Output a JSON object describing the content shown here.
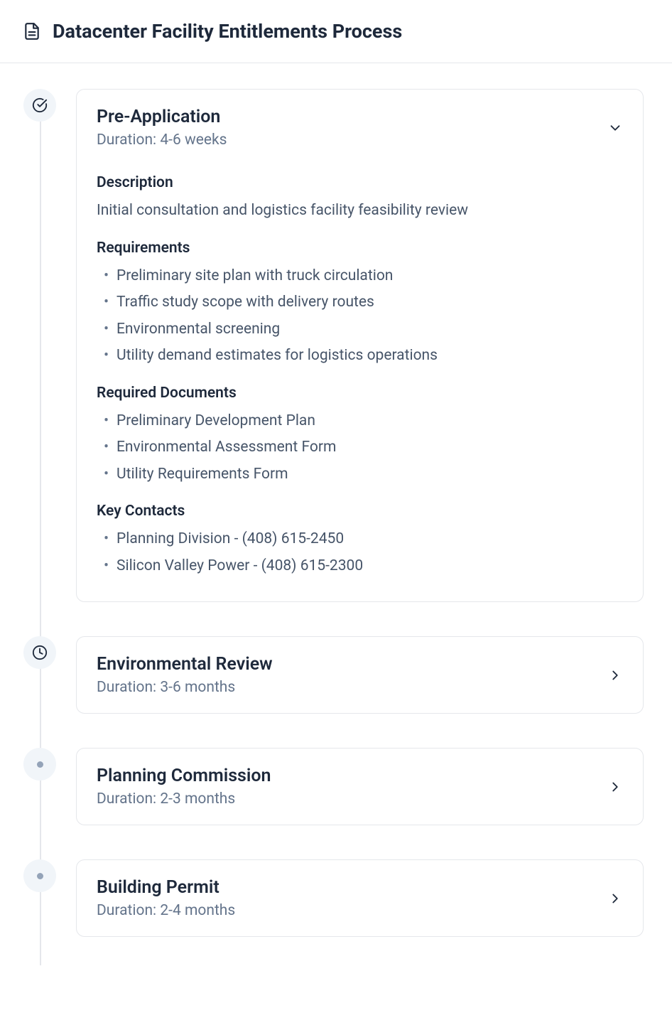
{
  "header": {
    "title": "Datacenter Facility Entitlements Process"
  },
  "steps": [
    {
      "title": "Pre-Application",
      "duration": "Duration: 4-6 weeks",
      "expanded": true,
      "description_label": "Description",
      "description": "Initial consultation and logistics facility feasibility review",
      "requirements_label": "Requirements",
      "requirements": [
        "Preliminary site plan with truck circulation",
        "Traffic study scope with delivery routes",
        "Environmental screening",
        "Utility demand estimates for logistics operations"
      ],
      "documents_label": "Required Documents",
      "documents": [
        "Preliminary Development Plan",
        "Environmental Assessment Form",
        "Utility Requirements Form"
      ],
      "contacts_label": "Key Contacts",
      "contacts": [
        "Planning Division - (408) 615-2450",
        "Silicon Valley Power - (408) 615-2300"
      ]
    },
    {
      "title": "Environmental Review",
      "duration": "Duration: 3-6 months",
      "expanded": false
    },
    {
      "title": "Planning Commission",
      "duration": "Duration: 2-3 months",
      "expanded": false
    },
    {
      "title": "Building Permit",
      "duration": "Duration: 2-4 months",
      "expanded": false
    }
  ]
}
